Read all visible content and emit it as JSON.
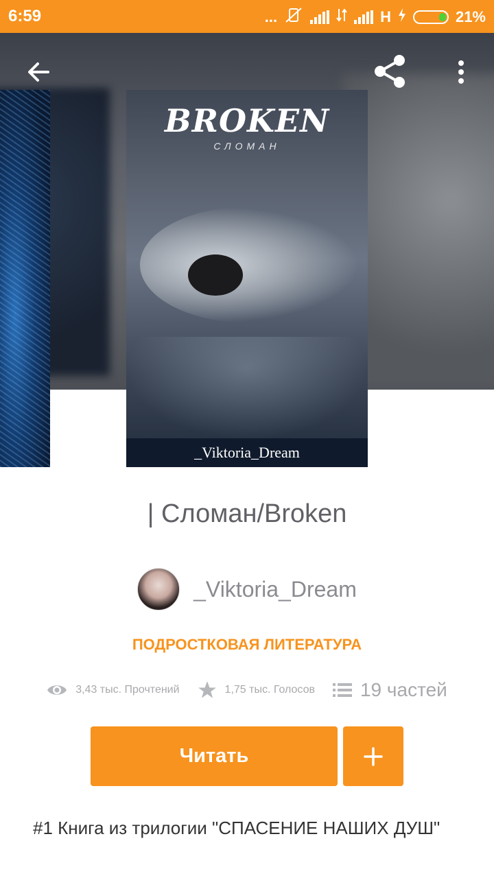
{
  "status_bar": {
    "time": "6:59",
    "dots": "...",
    "network_type": "H",
    "battery_percent": "21%",
    "battery_level": 0.21
  },
  "topbar": {
    "back_icon": "arrow-left-icon",
    "share_icon": "share-icon",
    "more_icon": "more-vertical-icon"
  },
  "cover": {
    "title": "BROKEN",
    "subtitle": "СЛОМАН",
    "author": "_Viktoria_Dream"
  },
  "book": {
    "title": "| Сломан/Broken",
    "author": "_Viktoria_Dream",
    "genre": "ПОДРОСТКОВАЯ ЛИТЕРАТУРА"
  },
  "stats": {
    "reads": "3,43 тыс. Прочтений",
    "votes": "1,75 тыс. Голосов",
    "parts": "19 частей"
  },
  "actions": {
    "read_label": "Читать",
    "add_symbol": "+"
  },
  "description": "#1 Книга из трилогии \"СПАСЕНИЕ НАШИХ ДУШ\"",
  "colors": {
    "accent": "#f7931e",
    "stat_text": "#a8a9ad"
  }
}
